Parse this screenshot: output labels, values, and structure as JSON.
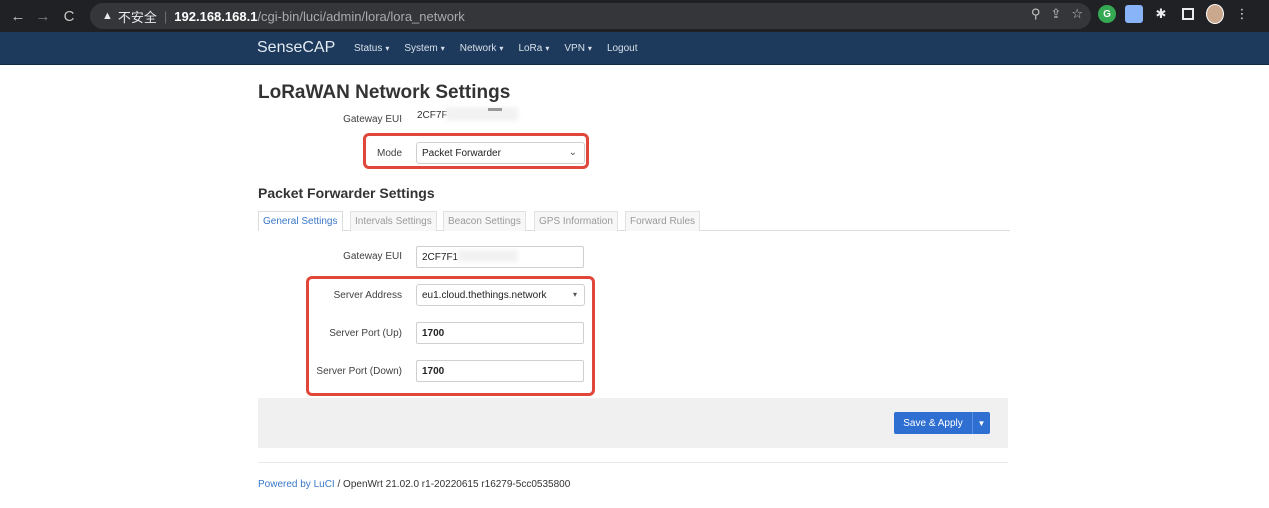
{
  "browser": {
    "insecure_label": "不安全",
    "url_host": "192.168.168.1",
    "url_path": "/cgi-bin/luci/admin/lora/lora_network"
  },
  "navbar": {
    "brand": "SenseCAP",
    "menu": [
      "Status",
      "System",
      "Network",
      "LoRa",
      "VPN",
      "Logout"
    ]
  },
  "page": {
    "title": "LoRaWAN Network Settings",
    "gateway_eui_label": "Gateway EUI",
    "gateway_eui_value": "2CF7F",
    "mode_label": "Mode",
    "mode_value": "Packet Forwarder"
  },
  "pf": {
    "title": "Packet Forwarder Settings",
    "tabs": [
      "General Settings",
      "Intervals Settings",
      "Beacon Settings",
      "GPS Information",
      "Forward Rules"
    ],
    "gateway_eui_label": "Gateway EUI",
    "gateway_eui_value": "2CF7F1",
    "server_address_label": "Server Address",
    "server_address_value": "eu1.cloud.thethings.network",
    "port_up_label": "Server Port (Up)",
    "port_up_value": "1700",
    "port_down_label": "Server Port (Down)",
    "port_down_value": "1700"
  },
  "actions": {
    "save_apply": "Save & Apply"
  },
  "footer": {
    "powered_by": "Powered by LuCI",
    "version": " / OpenWrt 21.02.0 r1-20220615 r16279-5cc0535800"
  },
  "colors": {
    "navbar": "#1d3a5c",
    "accent": "#2f6fd1",
    "highlight": "#e0473a"
  }
}
